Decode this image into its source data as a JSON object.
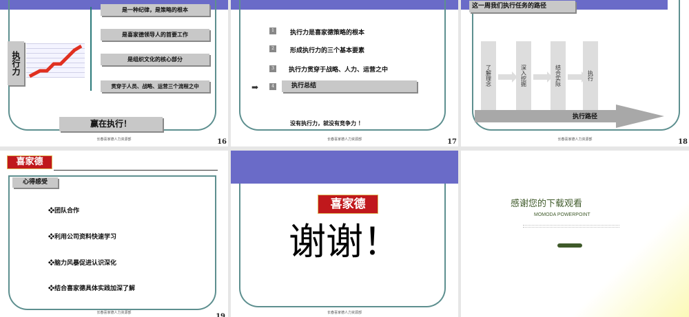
{
  "footer": "长春喜家德人力资源部",
  "slides": [
    {
      "page": "16",
      "side_label": "执行力",
      "boxes": [
        "是一种纪律，是策略的根本",
        "是喜家德领导人的首要工作",
        "是组织文化的核心部分",
        "贯穿于人员、战略、运营三个流程之中"
      ],
      "bottom": "赢在执行！"
    },
    {
      "page": "17",
      "items": [
        {
          "n": "1",
          "t": "执行力是喜家德策略的根本"
        },
        {
          "n": "2",
          "t": "形成执行力的三个基本要素"
        },
        {
          "n": "3",
          "t": "执行力贯穿于战略、人力、运营之中"
        },
        {
          "n": "4",
          "t": "执行总结"
        }
      ],
      "note": "没有执行力，就没有竞争力 ！"
    },
    {
      "page": "18",
      "title": "这一周我们执行任务的路径",
      "steps": [
        "了解理念",
        "深入挖掘",
        "结合实际",
        "执行"
      ],
      "path": "执行路径"
    },
    {
      "page": "19",
      "logo": "喜家德",
      "title": "心得感受",
      "items": [
        "❖团队合作",
        "❖利用公司资料快速学习",
        "❖脑力风暴促进认识深化",
        "❖结合喜家德具体实践加深了解"
      ]
    },
    {
      "logo": "喜家德",
      "thanks": "谢谢！"
    },
    {
      "title": "感谢您的下载观看",
      "subtitle": "MOMODA POWERPOINT"
    }
  ]
}
